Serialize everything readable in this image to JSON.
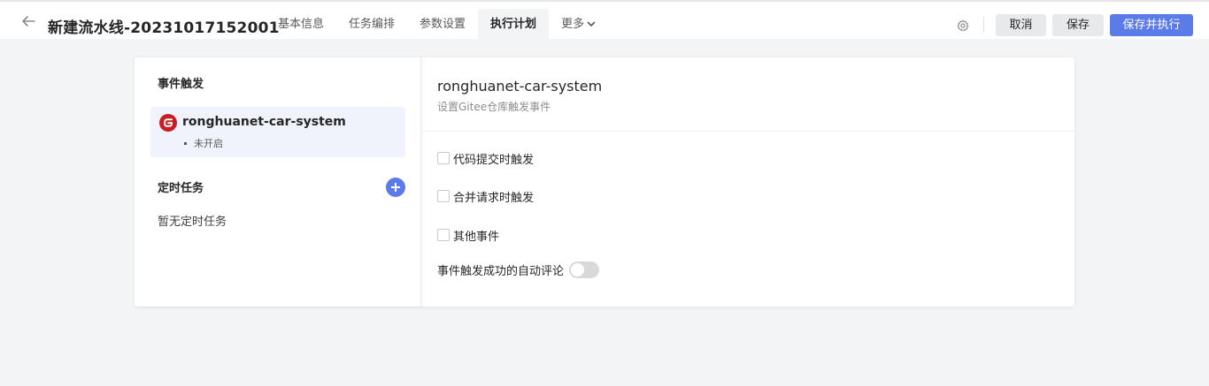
{
  "header": {
    "title": "新建流水线-20231017152001",
    "tabs": [
      {
        "label": "基本信息",
        "active": false
      },
      {
        "label": "任务编排",
        "active": false
      },
      {
        "label": "参数设置",
        "active": false
      },
      {
        "label": "执行计划",
        "active": true
      },
      {
        "label": "更多",
        "active": false
      }
    ],
    "cancel_label": "取消",
    "save_label": "保存",
    "save_run_label": "保存并执行",
    "accent_color": "#5b7be9"
  },
  "left": {
    "event_section_title": "事件触发",
    "trigger": {
      "name": "ronghuanet-car-system",
      "status": "未开启",
      "icon": "gitee-logo",
      "brand_color": "#c71d23"
    },
    "scheduled_section_title": "定时任务",
    "scheduled_empty": "暂无定时任务"
  },
  "right": {
    "title": "ronghuanet-car-system",
    "subtitle": "设置Gitee仓库触发事件",
    "options": [
      {
        "label": "代码提交时触发",
        "checked": false
      },
      {
        "label": "合并请求时触发",
        "checked": false
      },
      {
        "label": "其他事件",
        "checked": false
      }
    ],
    "auto_comment_label": "事件触发成功的自动评论",
    "auto_comment_enabled": false
  }
}
